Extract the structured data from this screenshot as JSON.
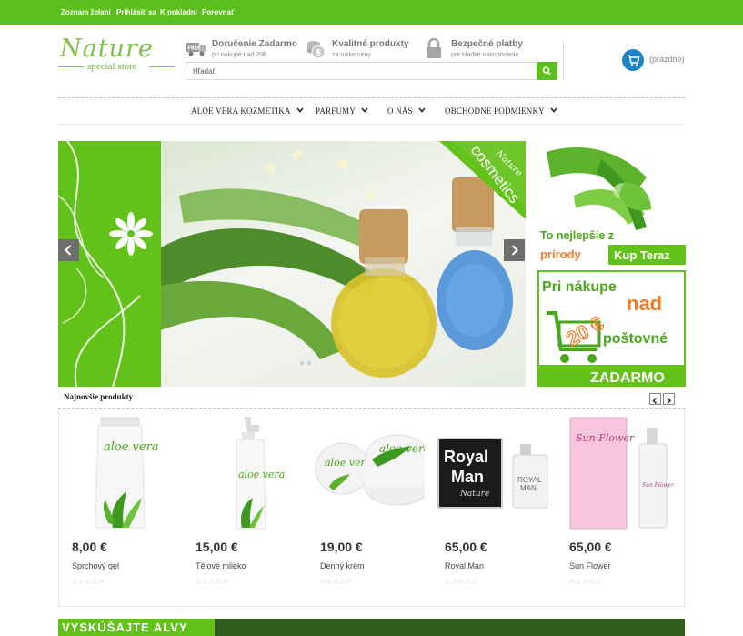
{
  "topbar": {
    "links": [
      "Zoznam želaní",
      "Prihlásiť sa",
      "K pokladni",
      "Porovnať"
    ]
  },
  "logo": {
    "script": "Nature",
    "sub": "special store"
  },
  "features": [
    {
      "title": "Doručenie Zadarmo",
      "small": "pri nákupe nad 20€",
      "icon": "free-delivery-icon"
    },
    {
      "title": "Kvalitné produkty",
      "small": "za nízke ceny",
      "icon": "coins-icon"
    },
    {
      "title": "Bezpečné platby",
      "small": "pre hladké nakupovanie",
      "icon": "lock-icon"
    }
  ],
  "search": {
    "placeholder": "Hľadať",
    "icon": "search-icon"
  },
  "cart": {
    "label": "(prázdne)",
    "icon": "cart-icon"
  },
  "nav": [
    {
      "label": "ALOE VERA KOZMETIKA"
    },
    {
      "label": "PARFUMY"
    },
    {
      "label": "O NÁS"
    },
    {
      "label": "OBCHODNE PODMIENKY"
    }
  ],
  "slider": {
    "ribbon_script": "Nature",
    "ribbon_text": "cosmetics",
    "prev_icon": "chevron-left-icon",
    "next_icon": "chevron-right-icon"
  },
  "promo1": {
    "line1": "To nejlepšie z",
    "line2": "prírody",
    "button": "Kup Teraz"
  },
  "promo2": {
    "line1": "Pri nákupe",
    "line2": "nad",
    "amount": "20 €",
    "line3": "poštovné",
    "line4": "ZADARMO"
  },
  "section": {
    "title": "Najnovšie produkty"
  },
  "products": [
    {
      "price": "8,00 €",
      "name": "Sprchový gel"
    },
    {
      "price": "15,00 €",
      "name": "Tělové mlieko"
    },
    {
      "price": "19,00 €",
      "name": "Denný krém"
    },
    {
      "price": "65,00 €",
      "name": "Royal Man"
    },
    {
      "price": "65,00 €",
      "name": "Sun Flower"
    }
  ],
  "product_labels": {
    "aloe": "aloe vera",
    "royal_l1": "Royal",
    "royal_l2": "Man",
    "royal_script": "Nature",
    "royal_bottle_l1": "ROYAL",
    "royal_bottle_l2": "MAN",
    "sun": "Sun Flower"
  },
  "bottom_banner": {
    "text": "VYSKÚŠAJTE ALVY"
  },
  "colors": {
    "brand_green": "#5cbf1e",
    "cart_blue": "#1f84c7",
    "accent_orange": "#f07c22"
  }
}
